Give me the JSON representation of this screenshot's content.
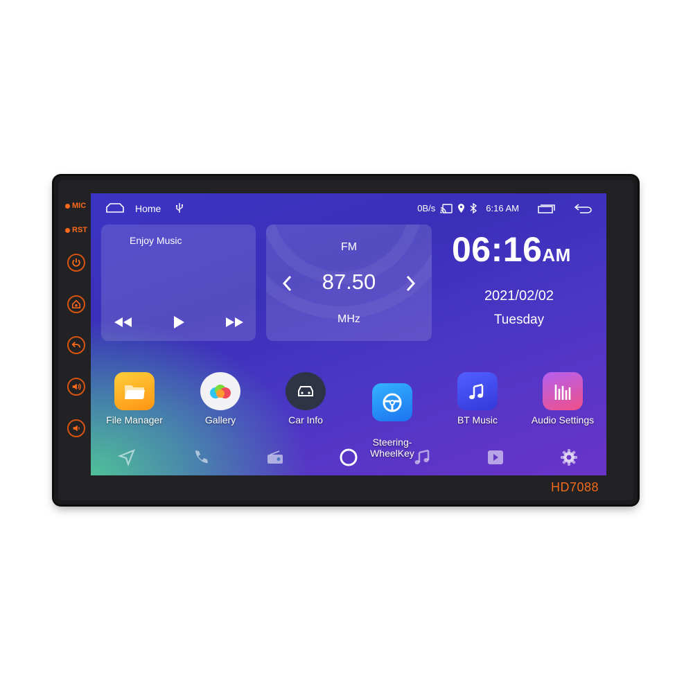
{
  "device": {
    "side_labels": [
      "MIC",
      "RST"
    ],
    "side_buttons": [
      "power-icon",
      "home-navi-icon",
      "back-icon",
      "volume-up-icon",
      "volume-down-icon"
    ],
    "model": "HD7088",
    "accent_color": "#ff6a1a"
  },
  "statusbar": {
    "home_label": "Home",
    "net_speed": "0B/s",
    "time": "6:16 AM",
    "icons": [
      "home-icon",
      "usb-icon",
      "cast-icon",
      "location-icon",
      "bluetooth-icon",
      "recent-apps-icon",
      "back-icon"
    ]
  },
  "music_widget": {
    "title": "Enjoy Music",
    "controls": [
      "previous",
      "play",
      "next"
    ]
  },
  "radio_widget": {
    "band": "FM",
    "frequency": "87.50",
    "unit": "MHz"
  },
  "clock_widget": {
    "time": "06:16",
    "ampm": "AM",
    "date": "2021/02/02",
    "weekday": "Tuesday"
  },
  "apps": [
    {
      "label": "File Manager",
      "icon": "folder-icon",
      "color": "#ffa41c"
    },
    {
      "label": "Gallery",
      "icon": "gallery-icon",
      "color": "#f2f2f5"
    },
    {
      "label": "Car Info",
      "icon": "car-icon",
      "color": "#2e3446"
    },
    {
      "label": "Steering-\nWheelKey",
      "icon": "steering-wheel-icon",
      "color": "#1e8ff5"
    },
    {
      "label": "BT Music",
      "icon": "bt-music-icon",
      "color": "#3d4bf0"
    },
    {
      "label": "Audio Settings",
      "icon": "equalizer-icon",
      "color": "#d453e0"
    }
  ],
  "dock": [
    "navigation-icon",
    "phone-icon",
    "radio-icon",
    "home-circle-icon",
    "music-icon",
    "video-icon",
    "settings-icon"
  ]
}
